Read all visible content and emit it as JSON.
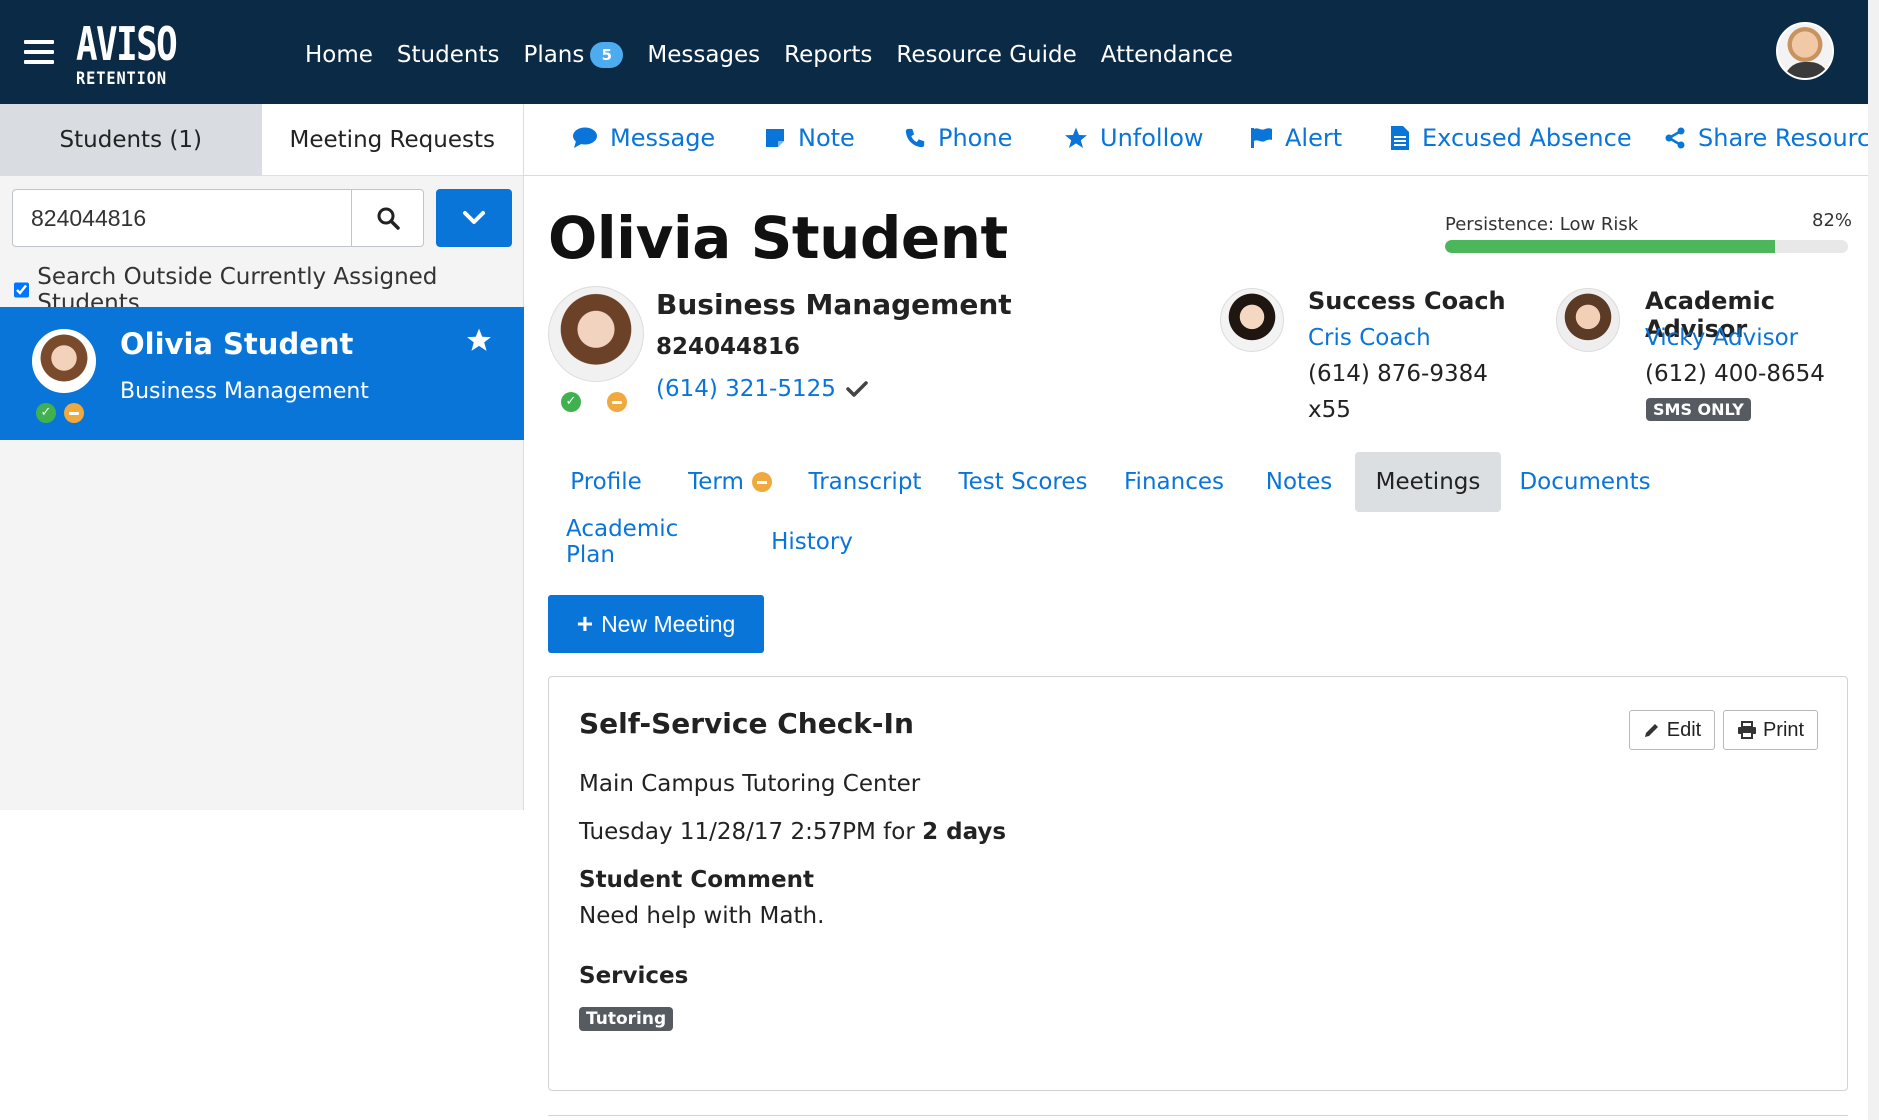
{
  "app": {
    "logo_main": "AVISO",
    "logo_sub": "RETENTION"
  },
  "nav": {
    "items": [
      {
        "label": "Home"
      },
      {
        "label": "Students"
      },
      {
        "label": "Plans",
        "badge": "5"
      },
      {
        "label": "Messages"
      },
      {
        "label": "Reports"
      },
      {
        "label": "Resource Guide"
      },
      {
        "label": "Attendance"
      }
    ]
  },
  "left": {
    "tabs": [
      {
        "label": "Students (1)",
        "active": true
      },
      {
        "label": "Meeting Requests",
        "active": false
      }
    ],
    "search": {
      "value": "824044816",
      "placeholder": ""
    },
    "outside_label": "Search Outside Currently Assigned Students",
    "student": {
      "name": "Olivia Student",
      "major": "Business Management"
    }
  },
  "actions": [
    {
      "label": "Message",
      "icon": "chat-icon"
    },
    {
      "label": "Note",
      "icon": "note-icon"
    },
    {
      "label": "Phone",
      "icon": "phone-icon"
    },
    {
      "label": "Unfollow",
      "icon": "star-icon"
    },
    {
      "label": "Alert",
      "icon": "flag-icon"
    },
    {
      "label": "Excused Absence",
      "icon": "document-icon"
    },
    {
      "label": "Share Resource",
      "icon": "share-icon"
    }
  ],
  "student": {
    "name": "Olivia Student",
    "major": "Business Management",
    "id": "824044816",
    "phone": "(614) 321-5125",
    "persistence": {
      "label": "Persistence: Low Risk",
      "percent_text": "82%",
      "value": 0.82
    }
  },
  "coach": {
    "role": "Success Coach",
    "name": "Cris Coach",
    "phone": "(614) 876-9384",
    "ext": "x55"
  },
  "advisor": {
    "role": "Academic Advisor",
    "name": "Vicky Advisor",
    "phone": "(612) 400-8654",
    "badge": "SMS ONLY"
  },
  "tabs": [
    {
      "label": "Profile"
    },
    {
      "label": "Term"
    },
    {
      "label": "Transcript"
    },
    {
      "label": "Test Scores"
    },
    {
      "label": "Finances"
    },
    {
      "label": "Notes"
    },
    {
      "label": "Meetings",
      "active": true
    },
    {
      "label": "Documents"
    },
    {
      "label": "Academic Plan"
    },
    {
      "label": "History"
    }
  ],
  "new_meeting_label": "New Meeting",
  "meeting": {
    "title": "Self-Service Check-In",
    "edit_label": "Edit",
    "print_label": "Print",
    "location": "Main Campus Tutoring Center",
    "when": "Tuesday 11/28/17 2:57PM for ",
    "duration": "2 days",
    "comment_label": "Student Comment",
    "comment": "Need help with Math.",
    "services_label": "Services",
    "services": [
      "Tutoring"
    ]
  },
  "colors": {
    "nav_bg": "#0b2a45",
    "accent": "#0a75d9",
    "success": "#4cb75a",
    "warning": "#f0a93e"
  }
}
